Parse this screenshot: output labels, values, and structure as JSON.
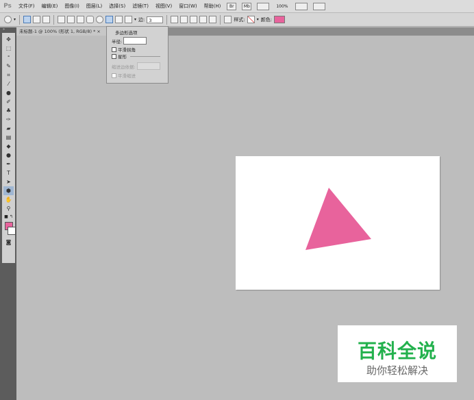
{
  "app": {
    "logo": "Ps"
  },
  "menu": [
    "文件(F)",
    "编辑(E)",
    "图像(I)",
    "图层(L)",
    "选择(S)",
    "滤镜(T)",
    "视图(V)",
    "窗口(W)",
    "帮助(H)"
  ],
  "menubar_tools": {
    "zoom": "100%",
    "br": "Br",
    "mb": "Mb"
  },
  "options": {
    "sides_label": "边:",
    "sides_value": "3",
    "style_label": "样式:",
    "color_label": "颜色:",
    "color_value": "#e8639c"
  },
  "document_tab": {
    "title": "未标题-1 @ 100% (形状 1, RGB/8) * ×"
  },
  "polygon_popup": {
    "title": "多边形选项",
    "radius_label": "半径:",
    "radius_value": "",
    "smooth_corners": "平滑拐角",
    "star": "星形",
    "indent_label": "缩进边依据:",
    "smooth_indents": "平滑缩进"
  },
  "toolbar": {
    "foreground_color": "#e8639c",
    "background_color": "#ffffff",
    "tools": [
      "move-icon",
      "marquee-icon",
      "lasso-icon",
      "quick-select-icon",
      "crop-icon",
      "eyedropper-icon",
      "healing-icon",
      "brush-icon",
      "stamp-icon",
      "history-brush-icon",
      "eraser-icon",
      "gradient-icon",
      "blur-icon",
      "dodge-icon",
      "pen-icon",
      "type-icon",
      "path-select-icon",
      "polygon-icon",
      "hand-icon",
      "zoom-icon"
    ]
  },
  "canvas": {
    "triangle_color": "#e8639c"
  },
  "watermark": {
    "title": "百科全说",
    "subtitle": "助你轻松解决"
  }
}
